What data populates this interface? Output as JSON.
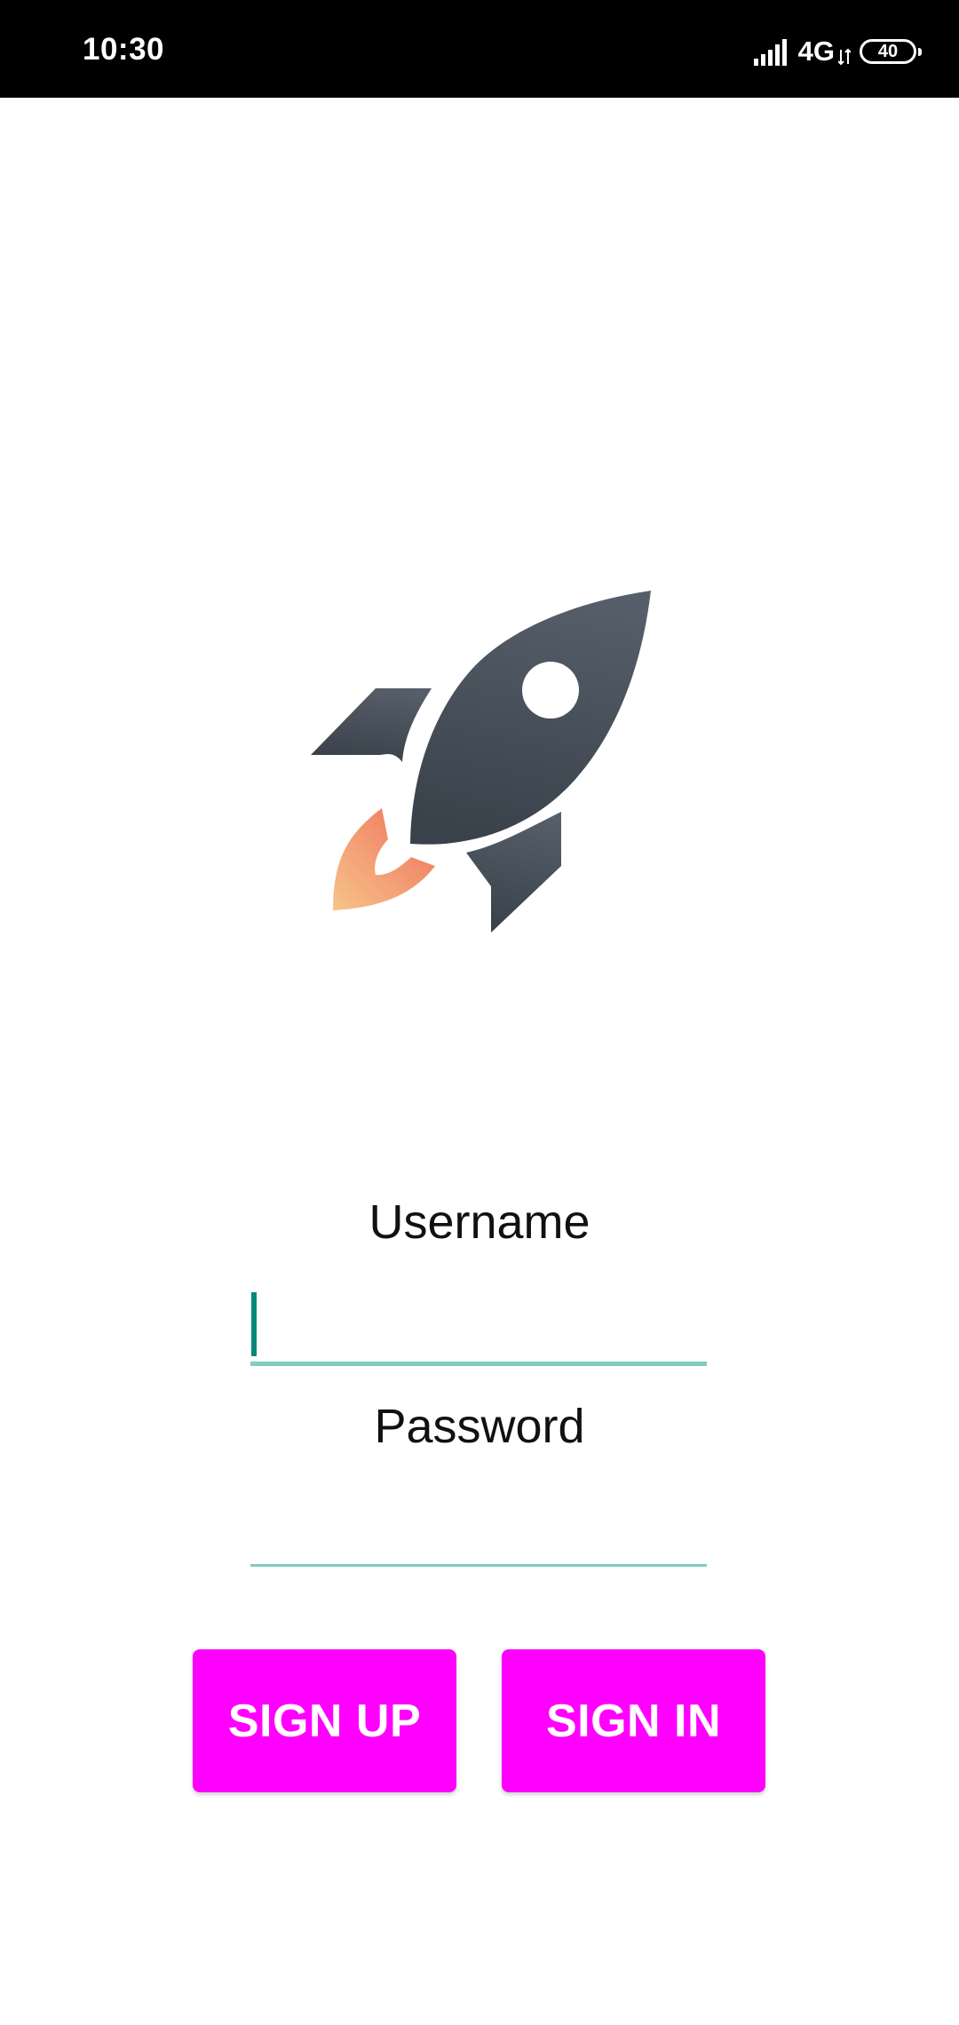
{
  "status_bar": {
    "time": "10:30",
    "network_type": "4G",
    "battery_level": "40",
    "icons": [
      "signal-icon",
      "data-arrows-icon",
      "battery-icon"
    ]
  },
  "logo": {
    "icon": "rocket-icon",
    "colors": {
      "body_light": "#565f69",
      "body_dark": "#39414b",
      "flame_light": "#f6c48a",
      "flame_dark": "#ef6f5a"
    }
  },
  "login_form": {
    "username_label": "Username",
    "username_value": "",
    "password_label": "Password",
    "password_value": "",
    "accent_color": "#00897b",
    "underline_color": "#80cbc4"
  },
  "actions": {
    "sign_up_label": "SIGN UP",
    "sign_in_label": "SIGN IN",
    "button_color": "#ff00ff"
  }
}
